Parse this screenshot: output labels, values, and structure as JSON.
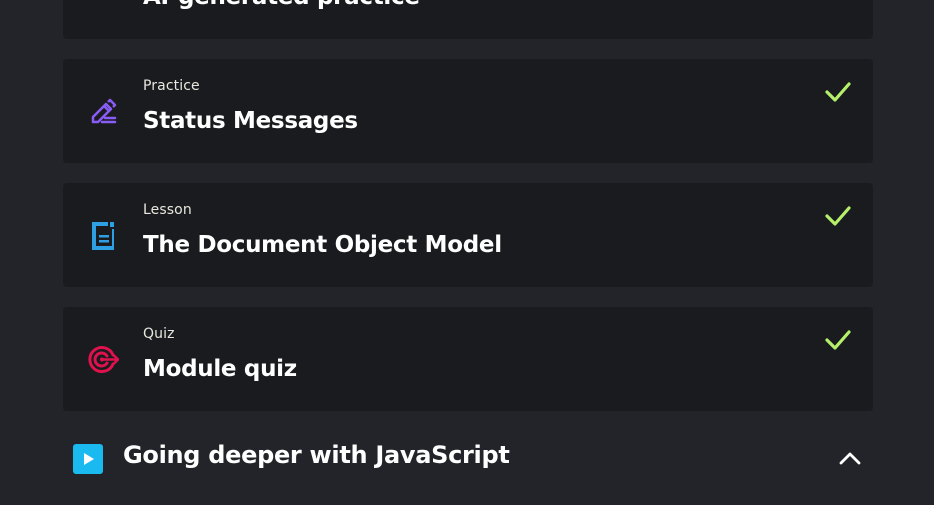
{
  "previous_item": {
    "title": "AI-generated practice"
  },
  "items": [
    {
      "type": "Practice",
      "title": "Status Messages",
      "icon": "pencil-icon",
      "completed": true,
      "icon_color": "#8a5cf6"
    },
    {
      "type": "Lesson",
      "title": "The Document Object Model",
      "icon": "document-icon",
      "completed": true,
      "icon_color": "#2f9fe4"
    },
    {
      "type": "Quiz",
      "title": "Module quiz",
      "icon": "target-icon",
      "completed": true,
      "icon_color": "#e0124e"
    }
  ],
  "next_section": {
    "title": "Going deeper with JavaScript",
    "icon": "play-icon",
    "expanded": true
  },
  "colors": {
    "check": "#b6f06b",
    "section_play": "#1ab9f0"
  }
}
